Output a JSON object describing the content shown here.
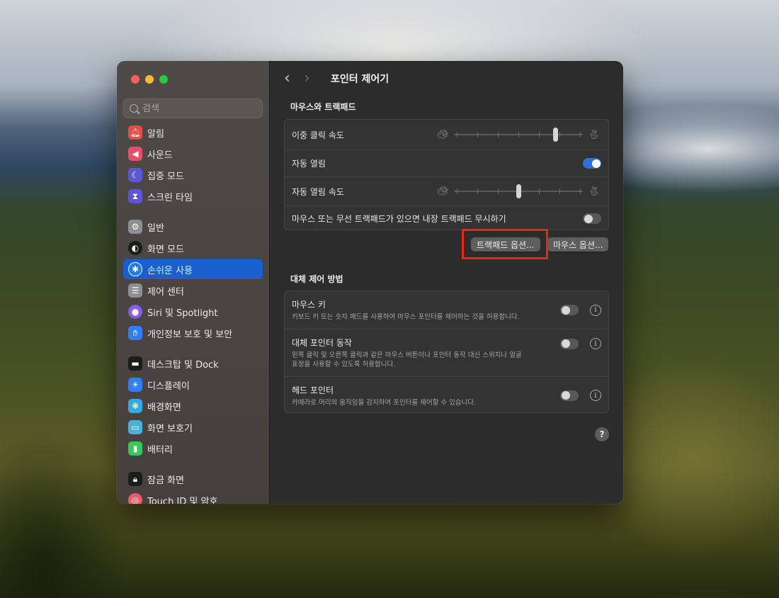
{
  "colors": {
    "accent": "#1a5fd0",
    "toggle_on": "#2f6fdc",
    "highlight_box": "#f0250e"
  },
  "search": {
    "placeholder": "검색"
  },
  "sidebar": {
    "items": [
      {
        "label": "알림",
        "icon": "bell-icon",
        "color": "#e94b45"
      },
      {
        "label": "사운드",
        "icon": "speaker-icon",
        "color": "#e94b6a"
      },
      {
        "label": "집중 모드",
        "icon": "moon-icon",
        "color": "#5b56d6"
      },
      {
        "label": "스크린 타임",
        "icon": "hourglass-icon",
        "color": "#5b56d6"
      },
      {
        "label": "일반",
        "icon": "gear-icon",
        "color": "#8e8e93"
      },
      {
        "label": "화면 모드",
        "icon": "appearance-icon",
        "color": "#1c1c1c"
      },
      {
        "label": "손쉬운 사용",
        "icon": "accessibility-icon",
        "color": "#1a7cf0",
        "active": true
      },
      {
        "label": "제어 센터",
        "icon": "control-center-icon",
        "color": "#8e8e93"
      },
      {
        "label": "Siri 및 Spotlight",
        "icon": "siri-icon",
        "color": "#b048e0"
      },
      {
        "label": "개인정보 보호 및 보안",
        "icon": "hand-icon",
        "color": "#2f7ef6"
      },
      {
        "label": "데스크탑 및 Dock",
        "icon": "dock-icon",
        "color": "#1c1c1c"
      },
      {
        "label": "디스플레이",
        "icon": "sun-icon",
        "color": "#2f7ef6"
      },
      {
        "label": "배경화면",
        "icon": "flower-icon",
        "color": "#34aadc"
      },
      {
        "label": "화면 보호기",
        "icon": "screensaver-icon",
        "color": "#4ab0d8"
      },
      {
        "label": "배터리",
        "icon": "battery-icon",
        "color": "#34c759"
      },
      {
        "label": "잠금 화면",
        "icon": "lock-icon",
        "color": "#1c1c1c"
      },
      {
        "label": "Touch ID 및 암호",
        "icon": "fingerprint-icon",
        "color": "#e85d6a"
      }
    ]
  },
  "header": {
    "back": "‹",
    "forward": "›",
    "title": "포인터 제어기"
  },
  "mouse_trackpad": {
    "section_title": "마우스와 트랙패드",
    "double_click_label": "이중 클릭 속도",
    "double_click_value": 0.8,
    "spring_loading_label": "자동 열림",
    "spring_loading_on": true,
    "spring_speed_label": "자동 열림 속도",
    "spring_speed_value": 0.5,
    "ignore_builtin_label": "마우스 또는 무선 트랙패드가 있으면 내장 트랙패드 무시하기",
    "ignore_builtin_on": false,
    "trackpad_options_button": "트랙패드 옵션...",
    "mouse_options_button": "마우스 옵션..."
  },
  "alternate": {
    "section_title": "대체 제어 방법",
    "mouse_keys_label": "마우스 키",
    "mouse_keys_desc": "키보드 키 또는 숫자 패드를 사용하여 마우스 포인터를 제어하는 것을 허용합니다.",
    "alt_pointer_label": "대체 포인터 동작",
    "alt_pointer_desc_1": "왼쪽 클릭 및 오른쪽 클릭과 같은 마우스 버튼이나 포인터 동작 대신 스위치나 얼굴",
    "alt_pointer_desc_2": "표정을 사용할 수 있도록 허용합니다.",
    "head_pointer_label": "헤드 포인터",
    "head_pointer_desc": "카메라로 머리의 움직임을 감지하여 포인터를 제어할 수 있습니다."
  },
  "help": "?"
}
